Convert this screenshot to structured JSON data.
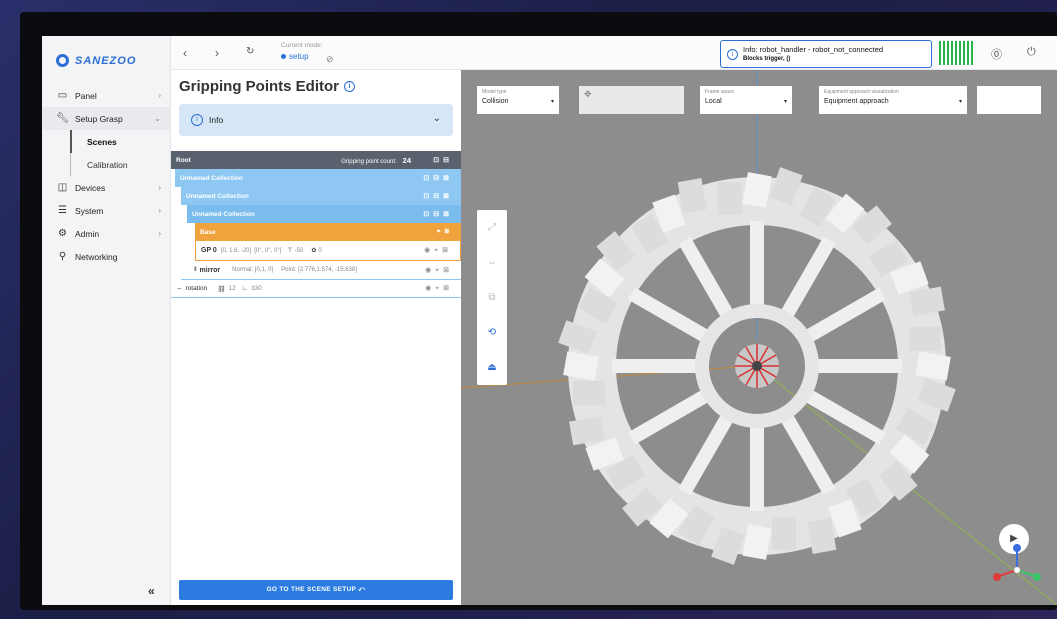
{
  "app": {
    "brand": "SANEZOO"
  },
  "sidebar": {
    "items": [
      {
        "label": "Panel",
        "icon": "monitor-icon"
      },
      {
        "label": "Setup Grasp",
        "icon": "wrench-icon"
      },
      {
        "label": "Devices",
        "icon": "devices-icon"
      },
      {
        "label": "System",
        "icon": "server-icon"
      },
      {
        "label": "Admin",
        "icon": "admin-icon"
      },
      {
        "label": "Networking",
        "icon": "network-icon"
      }
    ],
    "sub_items": [
      {
        "label": "Scenes"
      },
      {
        "label": "Calibration"
      }
    ],
    "collapse_label": "«"
  },
  "header": {
    "mode_label": "Current mode:",
    "mode_value": "setup",
    "notice_title": "Info: robot_handler - robot_not_connected",
    "notice_sub": "Blocks trigger, ()",
    "status_color": "#26b34a"
  },
  "editor": {
    "title": "Gripping Points Editor",
    "info_label": "Info",
    "root_label": "Root",
    "gp_count_label": "Gripping point count:",
    "gp_count": "24",
    "collections": [
      "Unnamed Collection",
      "Unnamed Collection",
      "Unnamed Collection"
    ],
    "base_label": "Base",
    "gp": {
      "name": "GP 0",
      "position": "[0, 1.6, -20]",
      "rotation": "[0°, 0°, 0°]",
      "depth": "-50",
      "suction": "0"
    },
    "mirror": {
      "label": "mirror",
      "normal": "Normal: [0,1, 0]",
      "point": "Point: [2.776,1.574, -15.638]"
    },
    "rotation": {
      "label": "rotation",
      "count": "12",
      "angle": "330"
    },
    "go_button": "GO TO THE SCENE SETUP"
  },
  "viewport": {
    "model_type_label": "Model type",
    "model_type_value": "Collision",
    "frame_label": "Frame space",
    "frame_value": "Local",
    "approach_label": "Equipment approach visualization",
    "approach_value": "Equipment approach"
  },
  "colors": {
    "accent": "#2b6fd6",
    "base": "#f0a23d",
    "collection": "#8ec7f2",
    "root": "#5a6270"
  }
}
